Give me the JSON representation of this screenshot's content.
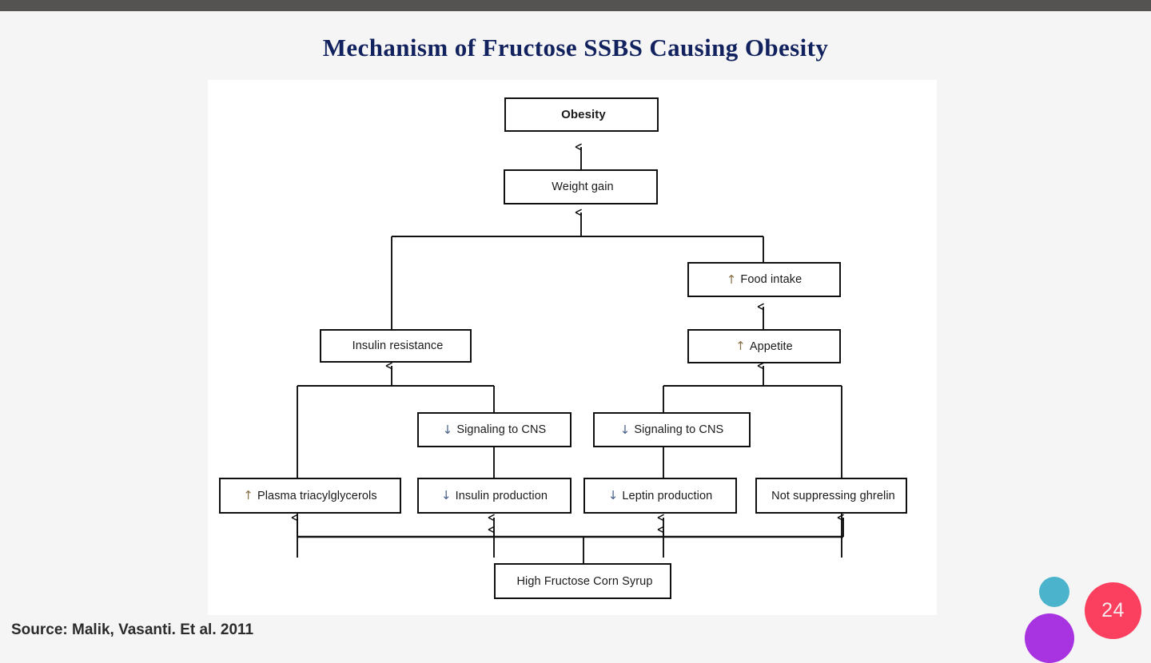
{
  "slide": {
    "title": "Mechanism of Fructose SSBS Causing Obesity",
    "source_note": "Source: Malik, Vasanti. Et al. 2011",
    "page_number": "24"
  },
  "colors": {
    "title": "#12225e",
    "topbar": "#555352",
    "slide_background": "#f5f5f5",
    "panel_background": "#ffffff",
    "node_border": "#101010",
    "up_arrow": "#8a7148",
    "down_arrow": "#47608a",
    "deco_teal": "#4bb3cc",
    "deco_purple": "#a833e0",
    "deco_pink": "#fb3f5e"
  },
  "diagram": {
    "type": "flowchart",
    "direction": "bottom-up",
    "nodes": [
      {
        "id": "obesity",
        "symbol": "",
        "label": "Obesity"
      },
      {
        "id": "weight-gain",
        "symbol": "",
        "label": "Weight gain"
      },
      {
        "id": "food-intake",
        "symbol": "↑",
        "label": "Food intake"
      },
      {
        "id": "insulin-resistance",
        "symbol": "",
        "label": "Insulin resistance"
      },
      {
        "id": "appetite",
        "symbol": "↑",
        "label": "Appetite"
      },
      {
        "id": "signaling-cns-left",
        "symbol": "↓",
        "label": "Signaling to CNS"
      },
      {
        "id": "signaling-cns-right",
        "symbol": "↓",
        "label": "Signaling to CNS"
      },
      {
        "id": "plasma-triacylglycerols",
        "symbol": "↑",
        "label": "Plasma triacylglycerols"
      },
      {
        "id": "insulin-production",
        "symbol": "↓",
        "label": "Insulin production"
      },
      {
        "id": "leptin-production",
        "symbol": "↓",
        "label": "Leptin production"
      },
      {
        "id": "ghrelin",
        "symbol": "",
        "label": "Not suppressing ghrelin"
      },
      {
        "id": "hfcs",
        "symbol": "",
        "label": "High Fructose Corn Syrup"
      }
    ],
    "edges": [
      {
        "from": "weight-gain",
        "to": "obesity"
      },
      {
        "from": "insulin-resistance",
        "to": "weight-gain"
      },
      {
        "from": "food-intake",
        "to": "weight-gain"
      },
      {
        "from": "appetite",
        "to": "food-intake"
      },
      {
        "from": "plasma-triacylglycerols",
        "to": "insulin-resistance"
      },
      {
        "from": "signaling-cns-left",
        "to": "insulin-resistance"
      },
      {
        "from": "signaling-cns-right",
        "to": "appetite"
      },
      {
        "from": "ghrelin",
        "to": "appetite"
      },
      {
        "from": "insulin-production",
        "to": "signaling-cns-left"
      },
      {
        "from": "leptin-production",
        "to": "signaling-cns-right"
      },
      {
        "from": "hfcs",
        "to": "plasma-triacylglycerols"
      },
      {
        "from": "hfcs",
        "to": "insulin-production"
      },
      {
        "from": "hfcs",
        "to": "leptin-production"
      },
      {
        "from": "hfcs",
        "to": "ghrelin"
      }
    ]
  }
}
